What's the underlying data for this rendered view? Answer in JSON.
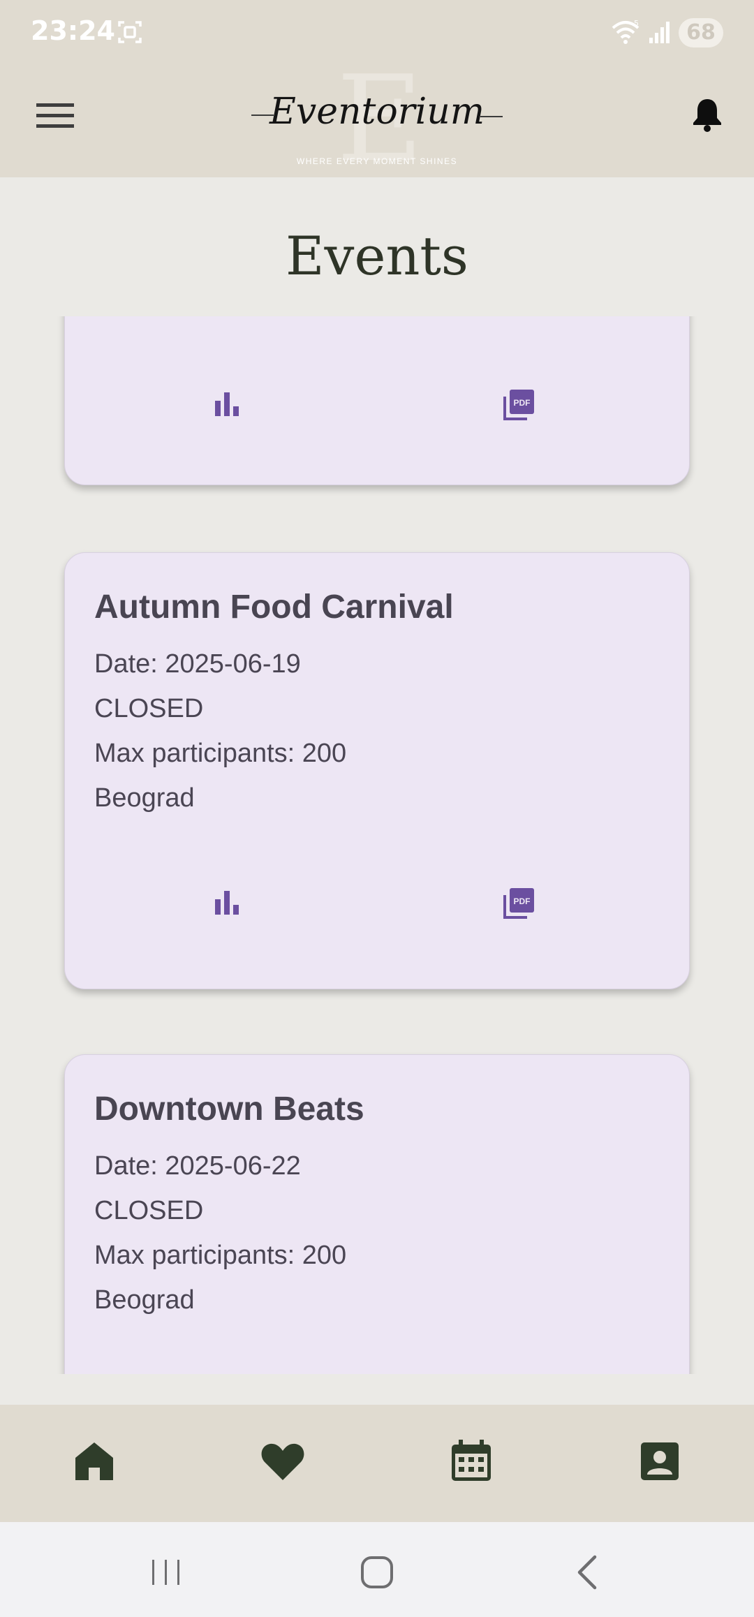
{
  "status_bar": {
    "time": "23:24",
    "battery": "68"
  },
  "header": {
    "app_name": "Eventorium",
    "tagline": "WHERE EVERY MOMENT SHINES",
    "logo_letter": "E"
  },
  "page": {
    "title": "Events"
  },
  "events": [
    {
      "title": "",
      "actions": [
        "statistics-icon",
        "pdf-icon"
      ]
    },
    {
      "title": "Autumn Food Carnival",
      "date": "Date: 2025-06-19",
      "status": "CLOSED",
      "max_participants": "Max participants: 200",
      "location": "Beograd",
      "actions": [
        "statistics-icon",
        "pdf-icon"
      ]
    },
    {
      "title": "Downtown Beats",
      "date": "Date: 2025-06-22",
      "status": "CLOSED",
      "max_participants": "Max participants: 200",
      "location": "Beograd"
    }
  ],
  "bottom_nav": [
    "home-icon",
    "heart-icon",
    "calendar-icon",
    "profile-icon"
  ],
  "colors": {
    "header_bg": "#E0DBD0",
    "card_bg": "#EDE6F4",
    "accent_purple": "#6B4FA0",
    "nav_dark": "#2F3D2A"
  }
}
